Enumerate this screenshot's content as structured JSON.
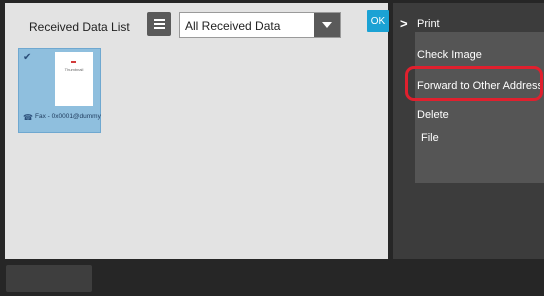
{
  "header": {
    "title": "Received Data List",
    "filter_value": "All Received Data",
    "ok_label": "OK"
  },
  "thumbnail": {
    "paper_text": "Thumbnail",
    "caption": "Fax - 0x0001@dummy",
    "selected": true
  },
  "menu": {
    "items": [
      "Print",
      "Check Image",
      "Forward to Other Address",
      "Delete",
      "File"
    ]
  },
  "colors": {
    "accent_ok": "#1ba2d4",
    "highlight": "#e0202e",
    "thumbnail_selected": "#8fbfde"
  },
  "icons": [
    "list-icon",
    "dropdown-arrow-icon",
    "check-icon",
    "phone-icon",
    "chevron-right-icon"
  ]
}
